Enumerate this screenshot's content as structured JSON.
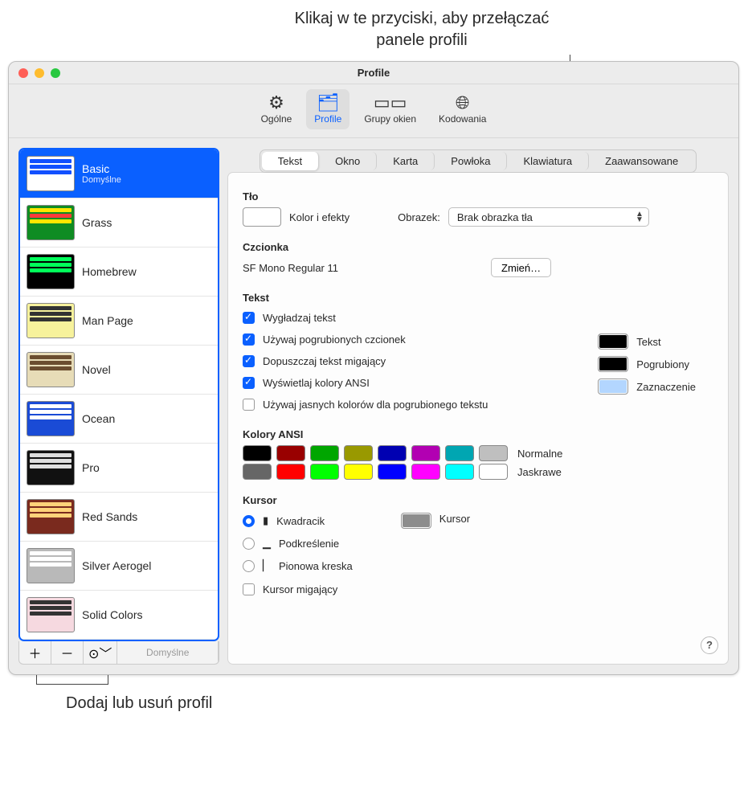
{
  "callouts": {
    "top": "Klikaj w te przyciski, aby przełączać panele profili",
    "bottom": "Dodaj lub usuń profil"
  },
  "window": {
    "title": "Profile"
  },
  "toolbar": {
    "general": "Ogólne",
    "profiles": "Profile",
    "window_groups": "Grupy okien",
    "encodings": "Kodowania"
  },
  "sidebar": {
    "default_label": "Domyślne",
    "action_default": "Domyślne",
    "profiles": [
      {
        "name": "Basic",
        "bg": "#ffffff",
        "bars": [
          "#1250ff",
          "#1250ff",
          "#1250ff"
        ],
        "sub": "Domyślne",
        "selected": true
      },
      {
        "name": "Grass",
        "bg": "#0f8c23",
        "bars": [
          "#ffe600",
          "#ff3a3a",
          "#ffe600"
        ]
      },
      {
        "name": "Homebrew",
        "bg": "#000000",
        "bars": [
          "#00ff5a",
          "#00ff5a",
          "#00ff5a"
        ]
      },
      {
        "name": "Man Page",
        "bg": "#f7f29c",
        "bars": [
          "#333",
          "#333",
          "#333"
        ]
      },
      {
        "name": "Novel",
        "bg": "#e7dcb7",
        "bars": [
          "#6b4d2f",
          "#6b4d2f",
          "#6b4d2f"
        ]
      },
      {
        "name": "Ocean",
        "bg": "#1a4bd6",
        "bars": [
          "#ffffff",
          "#ffffff",
          "#ffffff"
        ]
      },
      {
        "name": "Pro",
        "bg": "#111111",
        "bars": [
          "#ddd",
          "#ddd",
          "#ddd"
        ]
      },
      {
        "name": "Red Sands",
        "bg": "#7a2a1e",
        "bars": [
          "#ffd27a",
          "#ffd27a",
          "#ffd27a"
        ]
      },
      {
        "name": "Silver Aerogel",
        "bg": "#b9b9b9",
        "bars": [
          "#fff",
          "#fff",
          "#fff"
        ]
      },
      {
        "name": "Solid Colors",
        "bg": "#f6d9e0",
        "bars": [
          "#333",
          "#333",
          "#333"
        ]
      }
    ]
  },
  "tabs": {
    "text": "Tekst",
    "window": "Okno",
    "card": "Karta",
    "shell": "Powłoka",
    "keyboard": "Klawiatura",
    "advanced": "Zaawansowane"
  },
  "pane": {
    "bg": {
      "heading": "Tło",
      "color_effects": "Kolor i efekty",
      "image_label": "Obrazek:",
      "image_value": "Brak obrazka tła"
    },
    "font": {
      "heading": "Czcionka",
      "current": "SF Mono Regular 11",
      "change": "Zmień…"
    },
    "text": {
      "heading": "Tekst",
      "antialias": "Wygładzaj tekst",
      "bold": "Używaj pogrubionych czcionek",
      "blink": "Dopuszczaj tekst migający",
      "ansi": "Wyświetlaj kolory ANSI",
      "brightbold": "Używaj jasnych kolorów dla pogrubionego tekstu",
      "text_sw": "Tekst",
      "bold_sw": "Pogrubiony",
      "sel_sw": "Zaznaczenie"
    },
    "ansi": {
      "heading": "Kolory ANSI",
      "normal_label": "Normalne",
      "bright_label": "Jaskrawe",
      "normal": [
        "#000000",
        "#990000",
        "#00a600",
        "#999900",
        "#0000b2",
        "#b200b2",
        "#00a6b2",
        "#bfbfbf"
      ],
      "bright": [
        "#666666",
        "#ff0000",
        "#00ff00",
        "#ffff00",
        "#0000ff",
        "#ff00ff",
        "#00ffff",
        "#ffffff"
      ]
    },
    "cursor": {
      "heading": "Kursor",
      "block": "Kwadracik",
      "underline": "Podkreślenie",
      "vbar": "Pionowa kreska",
      "blink": "Kursor migający",
      "swatch": "Kursor"
    }
  }
}
